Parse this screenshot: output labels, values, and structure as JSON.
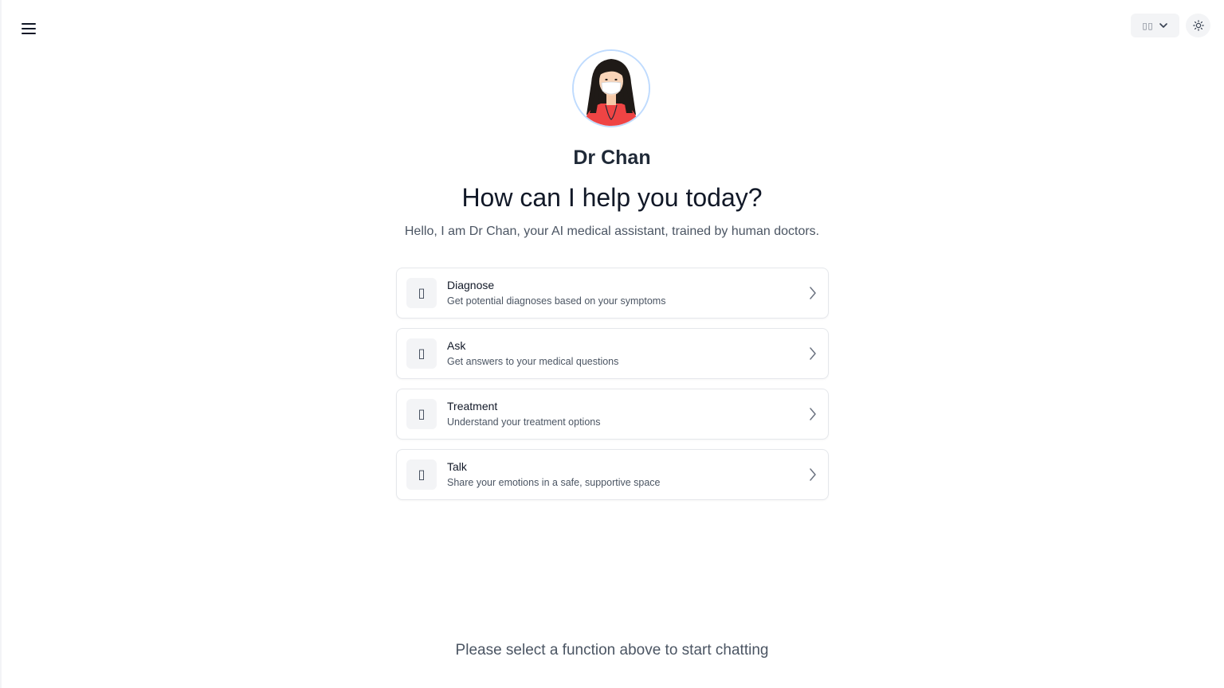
{
  "header": {
    "menu_icon": "hamburger-menu-icon",
    "language_flag": "▯▯",
    "language_icon": "chevron-down-icon",
    "theme_icon": "sun-icon"
  },
  "assistant": {
    "avatar_icon": "doctor-avatar",
    "name": "Dr Chan",
    "headline": "How can I help you today?",
    "intro": "Hello, I am Dr Chan, your AI medical assistant, trained by human doctors."
  },
  "options": [
    {
      "icon": "▯",
      "title": "Diagnose",
      "description": "Get potential diagnoses based on your symptoms"
    },
    {
      "icon": "▯",
      "title": "Ask",
      "description": "Get answers to your medical questions"
    },
    {
      "icon": "▯",
      "title": "Treatment",
      "description": "Understand your treatment options"
    },
    {
      "icon": "▯",
      "title": "Talk",
      "description": "Share your emotions in a safe, supportive space"
    }
  ],
  "footer": {
    "prompt": "Please select a function above to start chatting"
  },
  "colors": {
    "accent_border": "#bfdbfe",
    "avatar_shirt": "#ef4444",
    "text_dark": "#111827",
    "text_muted": "#4b5563"
  }
}
